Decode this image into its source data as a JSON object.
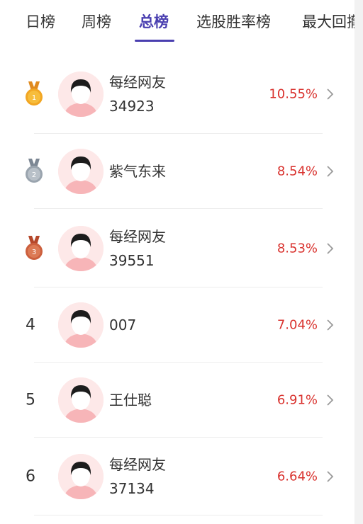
{
  "tabs": [
    {
      "label": "日榜",
      "active": false
    },
    {
      "label": "周榜",
      "active": false
    },
    {
      "label": "总榜",
      "active": true
    },
    {
      "label": "选股胜率榜",
      "active": false
    },
    {
      "label": "最大回撤",
      "active": false
    }
  ],
  "accent_color": "#4a3fb0",
  "rate_color": "#d9322e",
  "rows": [
    {
      "rank": "1",
      "medal": "gold",
      "name_line1": "每经网友",
      "name_line2": "34923",
      "rate": "10.55%"
    },
    {
      "rank": "2",
      "medal": "silver",
      "name_line1": "紫气东来",
      "name_line2": "",
      "rate": "8.54%"
    },
    {
      "rank": "3",
      "medal": "bronze",
      "name_line1": "每经网友",
      "name_line2": "39551",
      "rate": "8.53%"
    },
    {
      "rank": "4",
      "medal": "",
      "name_line1": "007",
      "name_line2": "",
      "rate": "7.04%"
    },
    {
      "rank": "5",
      "medal": "",
      "name_line1": "王仕聪",
      "name_line2": "",
      "rate": "6.91%"
    },
    {
      "rank": "6",
      "medal": "",
      "name_line1": "每经网友",
      "name_line2": "37134",
      "rate": "6.64%"
    }
  ],
  "icons": {
    "avatar": "default-user-avatar-icon",
    "chevron": "chevron-right-icon"
  }
}
